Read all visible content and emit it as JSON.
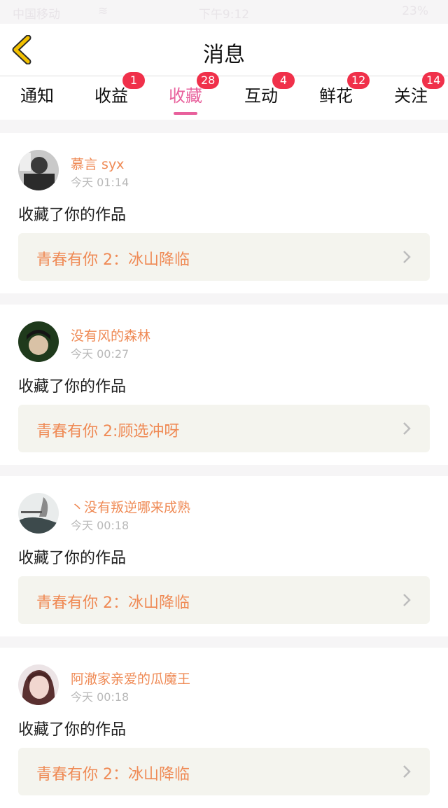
{
  "status": {
    "carrier": "中国移动",
    "time": "下午9:12",
    "battery": "23%"
  },
  "nav": {
    "title": "消息"
  },
  "tabs": [
    {
      "label": "通知",
      "badge": ""
    },
    {
      "label": "收益",
      "badge": "1"
    },
    {
      "label": "收藏",
      "badge": "28",
      "active": true
    },
    {
      "label": "互动",
      "badge": "4"
    },
    {
      "label": "鲜花",
      "badge": "12"
    },
    {
      "label": "关注",
      "badge": "14"
    }
  ],
  "colors": {
    "accent": "#e8609c",
    "badge": "#f0304a",
    "orange": "#ef8a55",
    "back": "#f2c000"
  },
  "messages": [
    {
      "user": "慕言 syx",
      "time": "今天 01:14",
      "action": "收藏了你的作品",
      "work": "青春有你 2：冰山降临"
    },
    {
      "user": "没有风的森林",
      "time": "今天 00:27",
      "action": "收藏了你的作品",
      "work": "青春有你 2:顾选冲呀"
    },
    {
      "user": "丶没有叛逆哪来成熟",
      "time": "今天 00:18",
      "action": "收藏了你的作品",
      "work": "青春有你 2：冰山降临"
    },
    {
      "user": "阿澈家亲爱的瓜魔王",
      "time": "今天 00:18",
      "action": "收藏了你的作品",
      "work": "青春有你 2：冰山降临"
    }
  ]
}
